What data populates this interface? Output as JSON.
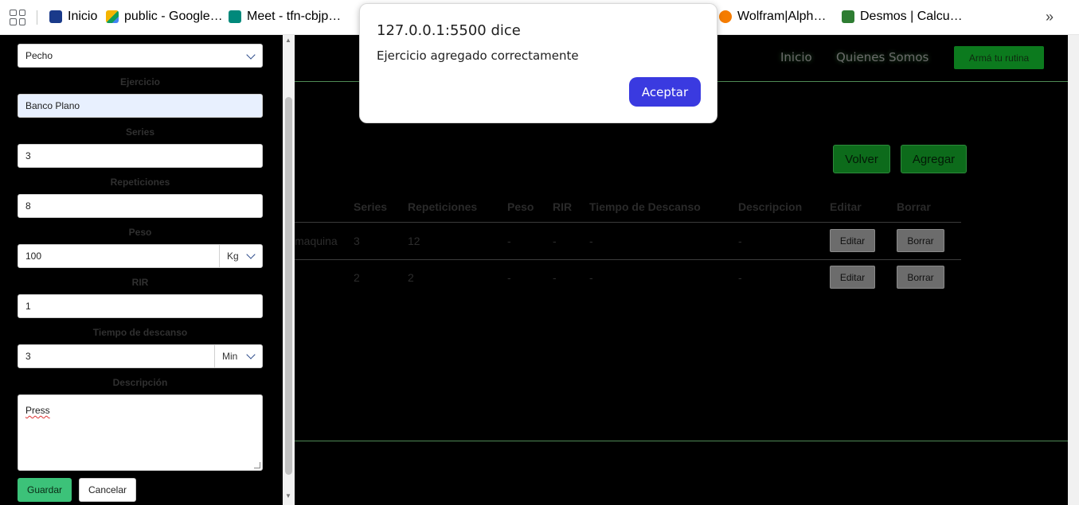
{
  "bookmarks": {
    "items": [
      {
        "label": "Inicio",
        "color": "#1a3a8a"
      },
      {
        "label": "public - Google…",
        "color": "#f4b400"
      },
      {
        "label": "Meet - tfn-cbjp…",
        "color": "#00897b"
      },
      {
        "label": "Wolfram|Alph…",
        "color": "#f57c00"
      },
      {
        "label": "Desmos | Calcu…",
        "color": "#2e7d32"
      }
    ],
    "more": "»"
  },
  "navbar": {
    "links": [
      "Inicio",
      "Quienes Somos"
    ],
    "cta": "Armá tu rutina"
  },
  "actions": {
    "back": "Volver",
    "add": "Agregar"
  },
  "table": {
    "headers": [
      "Series",
      "Repeticiones",
      "Peso",
      "RIR",
      "Tiempo de Descanso",
      "Descripcion",
      "Editar",
      "Borrar"
    ],
    "rows": [
      {
        "name_tail": "maquina",
        "series": "3",
        "reps": "12",
        "peso": "-",
        "rir": "-",
        "descanso": "-",
        "descripcion": "-",
        "edit": "Editar",
        "del": "Borrar"
      },
      {
        "name_tail": "",
        "series": "2",
        "reps": "2",
        "peso": "-",
        "rir": "-",
        "descanso": "-",
        "descripcion": "-",
        "edit": "Editar",
        "del": "Borrar"
      }
    ]
  },
  "form": {
    "muscle": "Pecho",
    "ejercicio_label": "Ejercicio",
    "ejercicio": "Banco Plano",
    "series_label": "Series",
    "series": "3",
    "reps_label": "Repeticiones",
    "reps": "8",
    "peso_label": "Peso",
    "peso": "100",
    "peso_unit": "Kg",
    "rir_label": "RIR",
    "rir": "1",
    "descanso_label": "Tiempo de descanso",
    "descanso": "3",
    "descanso_unit": "Min",
    "desc_label": "Descripción",
    "descripcion": "Press",
    "save": "Guardar",
    "cancel": "Cancelar"
  },
  "dialog": {
    "title": "127.0.0.1:5500 dice",
    "message": "Ejercicio agregado correctamente",
    "ok": "Aceptar"
  }
}
